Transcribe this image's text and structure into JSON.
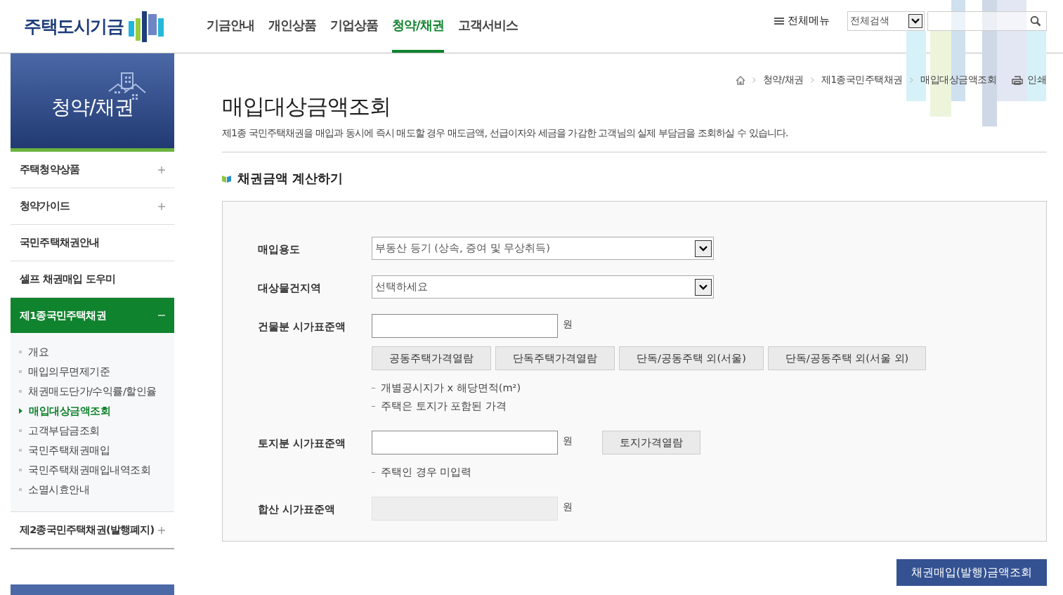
{
  "header": {
    "logo": "주택도시기금",
    "nav": [
      {
        "label": "기금안내",
        "selected": false
      },
      {
        "label": "개인상품",
        "selected": false
      },
      {
        "label": "기업상품",
        "selected": false
      },
      {
        "label": "청약/채권",
        "selected": true
      },
      {
        "label": "고객서비스",
        "selected": false
      }
    ],
    "all_menu": "전체메뉴",
    "search_scope": "전체검색"
  },
  "sidebar": {
    "title": "청약/채권",
    "items": [
      {
        "label": "주택청약상품",
        "expanded": false,
        "expandable": true
      },
      {
        "label": "청약가이드",
        "expanded": false,
        "expandable": true
      },
      {
        "label": "국민주택채권안내",
        "expanded": false,
        "expandable": false
      },
      {
        "label": "셀프 채권매입 도우미",
        "expanded": false,
        "expandable": false
      },
      {
        "label": "제1종국민주택채권",
        "expanded": true,
        "expandable": true,
        "children": [
          {
            "label": "개요",
            "selected": false
          },
          {
            "label": "매입의무면제기준",
            "selected": false
          },
          {
            "label": "채권매도단가/수익률/할인율",
            "selected": false
          },
          {
            "label": "매입대상금액조회",
            "selected": true
          },
          {
            "label": "고객부담금조회",
            "selected": false
          },
          {
            "label": "국민주택채권매입",
            "selected": false
          },
          {
            "label": "국민주택채권매입내역조회",
            "selected": false
          },
          {
            "label": "소멸시효안내",
            "selected": false
          }
        ]
      },
      {
        "label": "제2종국민주택채권(발행폐지)",
        "expanded": false,
        "expandable": true
      }
    ]
  },
  "breadcrumb": [
    "청약/채권",
    "제1종국민주택채권",
    "매입대상금액조회"
  ],
  "print": "인쇄",
  "page_title": "매입대상금액조회",
  "description": "제1종 국민주택채권을 매입과 동시에 즉시 매도할 경우 매도금액, 선급이자와 세금을 가감한 고객님의 실제 부담금을 조회하실 수 있습니다.",
  "section_title": "채권금액 계산하기",
  "form": [
    {
      "kind": "select",
      "label": "매입용도",
      "value": "부동산 등기 (상속, 증여 및 무상취득)"
    },
    {
      "kind": "select",
      "label": "대상물건지역",
      "value": "선택하세요"
    },
    {
      "kind": "input",
      "label": "건물분 시가표준액",
      "unit": "원",
      "buttons": [
        "공동주택가격열람",
        "단독주택가격열람",
        "단독/공동주택 외(서울)",
        "단독/공동주택 외(서울 외)"
      ],
      "notes": [
        "개별공시지가 x 해당면적(m²)",
        "주택은 토지가 포함된 가격"
      ]
    },
    {
      "kind": "input",
      "label": "토지분 시가표준액",
      "unit": "원",
      "buttons": [
        "토지가격열람"
      ],
      "notes": [
        "주택인 경우 미입력"
      ]
    },
    {
      "kind": "readonly",
      "label": "합산 시가표준액",
      "unit": "원"
    }
  ],
  "submit": "채권매입(발행)금액조회"
}
